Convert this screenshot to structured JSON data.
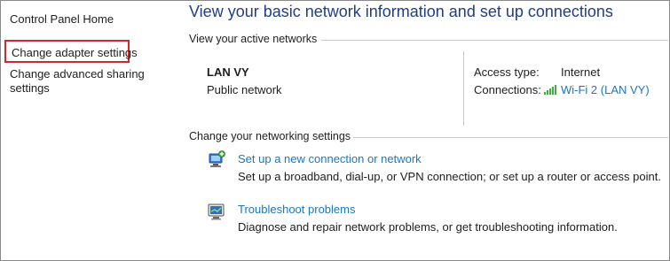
{
  "left_nav": {
    "home": "Control Panel Home",
    "adapter": "Change adapter settings",
    "sharing": "Change advanced sharing settings"
  },
  "main": {
    "title": "View your basic network information and set up connections",
    "active_networks_heading": "View your active networks",
    "network": {
      "name": "LAN VY",
      "category": "Public network",
      "access_type_label": "Access type:",
      "access_type_value": "Internet",
      "connections_label": "Connections:",
      "connections_value": "Wi-Fi 2 (LAN VY)"
    },
    "settings_heading": "Change your networking settings",
    "tasks": [
      {
        "link": "Set up a new connection or network",
        "description": "Set up a broadband, dial-up, or VPN connection; or set up a router or access point.",
        "icon": "network-setup-icon"
      },
      {
        "link": "Troubleshoot problems",
        "description": "Diagnose and repair network problems, or get troubleshooting information.",
        "icon": "troubleshoot-icon"
      }
    ]
  },
  "colors": {
    "title": "#1e3d8c",
    "link": "#1b76c7",
    "highlight_border": "#d6252b",
    "wifi_bars": "#3fae3f"
  }
}
